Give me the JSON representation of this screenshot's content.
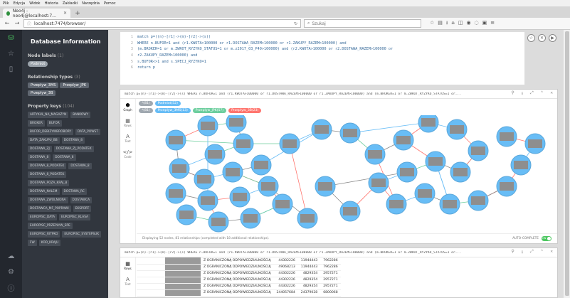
{
  "browser": {
    "menu": [
      "Plik",
      "Edycja",
      "Widok",
      "Historia",
      "Zakładki",
      "Narzędzia",
      "Pomoc"
    ],
    "tab_title": "Neo4j - neo4j@localhost:7...",
    "url": "localhost:7474/browser/",
    "search_placeholder": "Szukaj"
  },
  "sidebar": {
    "title": "Database Information",
    "node_labels_heading": "Node labels",
    "node_labels_count": "(1)",
    "node_labels": [
      "Podmiot"
    ],
    "rel_types_heading": "Relationship types",
    "rel_types_count": "(3)",
    "rel_types": [
      "Przeplyw_3MS",
      "Przeplyw_JPK",
      "Przeplyw_3B"
    ],
    "property_keys_heading": "Property keys",
    "property_keys_count": "(104)",
    "property_keys": [
      "ARTYKUL_NA_MAGAZYN",
      "BANKOWY",
      "BROKER",
      "BUFOR",
      "BUFOR_DEBIZYWBROBORY",
      "DATA_POWST",
      "DATA_ZAKUPU_BB",
      "DOSTAWA_8",
      "DOSTAWA_ZJ",
      "DOSTAWA_ZJ_PODATEK",
      "DOSTAWA_8",
      "DOSTAWA_8",
      "DOSTAWA_8_PODATEK",
      "DOSTAWA_8",
      "DOSTAWA_8_PODATEK",
      "DOSTAWA_POZA_KRAJ_8",
      "DOSTAWA_NALEM",
      "DOSTAWA_RC",
      "DOSTAWA_ZWOLNIONA",
      "DOSTAWCA",
      "DOSTAWCA_MF_POPRAWI",
      "EKSPORT",
      "EUROPISC_DATA",
      "EUROPISC_KLASA",
      "EUROPISC_PRZEPLYW_SPE",
      "EUROPISC_RITPKO",
      "EUROPISC_SYSTEPSUK",
      "FW",
      "KOD_KRAJU"
    ]
  },
  "editor": {
    "lines": [
      "match p=((n)-[r1]->(m)-[r2]->(s))",
      "WHERE n.BUFOR=1 and (r1.KWOTA>100000 or r1.DOSTAWA_RAZEM>100000 or r1.ZAKUPY_RAZEM>100000) and",
      "(m.BROKER=1 or m.ZWROT_RYZYKO_STATUS=1 or m.z2017_03_P49>100000) and (r2.KWOTA>100000 or r2.DOSTAWA_RAZEM>100000 or",
      "r2.ZAKUPY_RAZEM>100000) and",
      "s.BUFOR<>1 and s.SPECJ_RYZYKO=1",
      "return p"
    ]
  },
  "frame1": {
    "query": "match p=(n)-[r1]->(m)-[r2]->(s) WHERE n.BUFOR=1 and (r1.KWOTA>100000 or r1.DOSTAWA_RAZEM>100000 or r1.ZAKUPY_RAZEM>100000) and (m.BROKER=1 or m.ZWROT_RYZYKO_STATUS=1 or...",
    "side": [
      "Graph",
      "Rows",
      "Text",
      "Code"
    ],
    "legend_all": "*(81)",
    "legend_node": "Podmiot(52)",
    "legend_rels": [
      "Przeplyw_3MS(13)",
      "Przeplyw_JPK(57)",
      "Przeplyw_3B(23)"
    ],
    "status": "Displaying 52 nodes, 81 relationships (completed with 18 additional relationships).",
    "autocomplete_label": "AUTO-COMPLETE",
    "toggle_label": "ON"
  },
  "frame2": {
    "query": "match p=(n)-[r1]->(m)-[r2]->(s) WHERE n.BUFOR=1 and (r1.KWOTA>100000 or r1.DOSTAWA_RAZEM>100000 or r1.ZAKUPY_RAZEM>100000) and (m.BROKER=1 or m.ZWROT_RYZYKO_STATUS=1 or...",
    "side": [
      "Rows",
      "Text"
    ],
    "rows": [
      [
        "",
        "",
        "Z OGRANICZONĄ ODPOWIEDZIALNOŚCIĄ",
        "44302226",
        "11944443",
        "7962286"
      ],
      [
        "",
        "",
        "Z OGRANICZONĄ ODPOWIEDZIALNOŚCIĄ",
        "49068213",
        "11944443",
        "7962286"
      ],
      [
        "",
        "",
        "Z OGRANICZONĄ ODPOWIEDZIALNOŚCIĄ",
        "44302226",
        "4829354",
        "2957271"
      ],
      [
        "",
        "",
        "Z OGRANICZONĄ ODPOWIEDZIALNOŚCIĄ",
        "44302226",
        "4829354",
        "2957271"
      ],
      [
        "",
        "",
        "Z OGRANICZONĄ ODPOWIEDZIALNOŚCIĄ",
        "44302226",
        "4829354",
        "2957271"
      ],
      [
        "",
        "",
        "Z OGRANICZONĄ ODPOWIEDZIALNOŚCIĄ",
        "244057684",
        "24379028",
        "6800068"
      ]
    ]
  },
  "colors": {
    "node": "#68bdf6",
    "rel1": "#68bdf6",
    "rel2": "#6dce9e",
    "rel3": "#ff756e",
    "accent": "#4cc760"
  }
}
